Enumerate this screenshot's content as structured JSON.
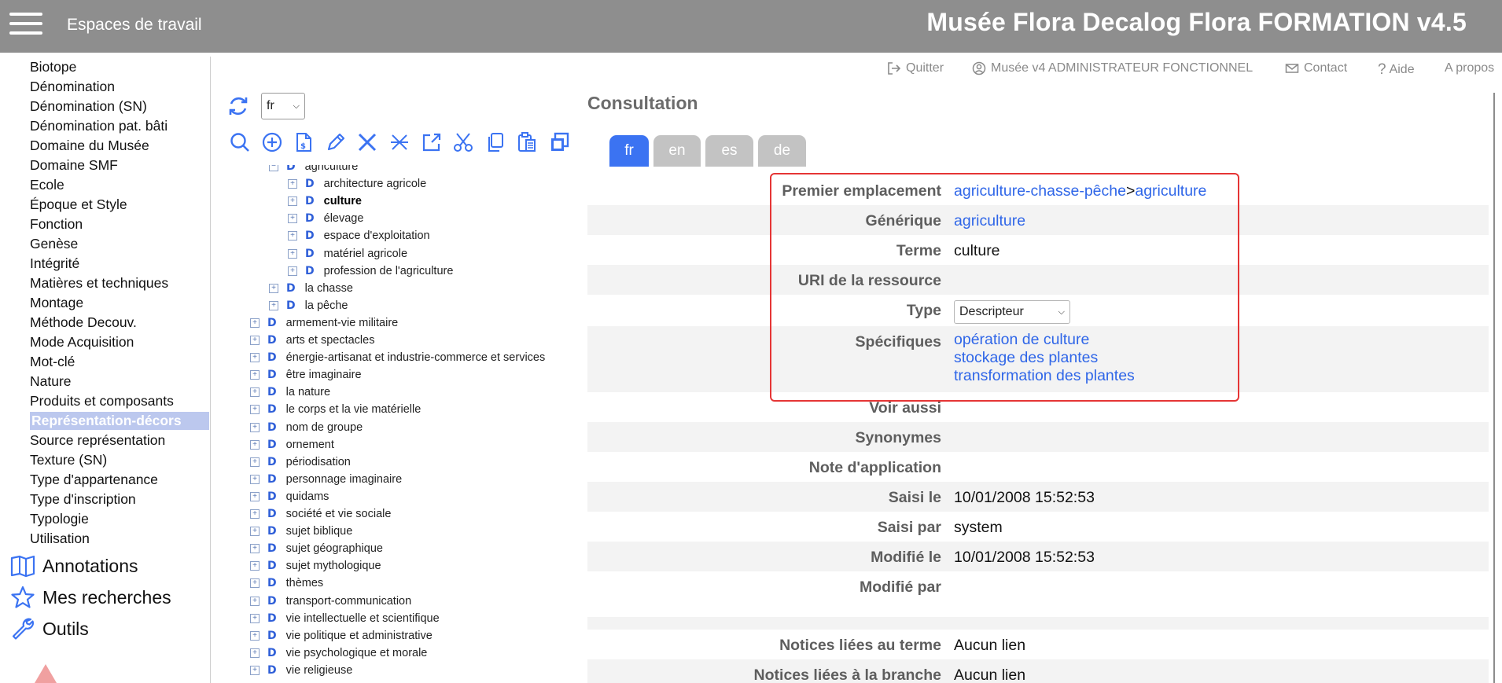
{
  "header": {
    "workspaces_label": "Espaces de travail",
    "app_title": "Musée Flora Decalog Flora FORMATION v4.5"
  },
  "sidebar": {
    "items": [
      "Biotope",
      "Dénomination",
      "Dénomination (SN)",
      "Dénomination pat. bâti",
      "Domaine du Musée",
      "Domaine SMF",
      "Ecole",
      "Époque et Style",
      "Fonction",
      "Genèse",
      "Intégrité",
      "Matières et techniques",
      "Montage",
      "Méthode Decouv.",
      "Mode Acquisition",
      "Mot-clé",
      "Nature",
      "Produits et composants",
      "Représentation-décors",
      "Source représentation",
      "Texture (SN)",
      "Type d'appartenance",
      "Type d'inscription",
      "Typologie",
      "Utilisation"
    ],
    "active_item": "Représentation-décors",
    "sections": {
      "annotations": "Annotations",
      "searches": "Mes recherches",
      "tools": "Outils"
    }
  },
  "toplinks": {
    "quit": "Quitter",
    "user": "Musée v4 ADMINISTRATEUR FONCTIONNEL",
    "contact": "Contact",
    "help": "Aide",
    "about": "A propos"
  },
  "tree_panel": {
    "language": "fr",
    "toolbar_icons": [
      "search-icon",
      "add-icon",
      "new-document-icon",
      "edit-icon",
      "delete-icon",
      "unlink-icon",
      "export-icon",
      "cut-icon",
      "copy-icon",
      "paste-icon",
      "duplicate-icon"
    ],
    "nodes": [
      {
        "label": "agriculture",
        "level": 2,
        "sign": "−"
      },
      {
        "label": "architecture agricole",
        "level": 3,
        "sign": "+"
      },
      {
        "label": "culture",
        "level": 3,
        "sign": "+",
        "bold": true
      },
      {
        "label": "élevage",
        "level": 3,
        "sign": "+"
      },
      {
        "label": "espace d'exploitation",
        "level": 3,
        "sign": "+"
      },
      {
        "label": "matériel agricole",
        "level": 3,
        "sign": "+"
      },
      {
        "label": "profession de l'agriculture",
        "level": 3,
        "sign": "+"
      },
      {
        "label": "la chasse",
        "level": 2,
        "sign": "+"
      },
      {
        "label": "la pêche",
        "level": 2,
        "sign": "+"
      },
      {
        "label": "armement-vie militaire",
        "level": 1,
        "sign": "+"
      },
      {
        "label": "arts et spectacles",
        "level": 1,
        "sign": "+"
      },
      {
        "label": "énergie-artisanat et industrie-commerce et services",
        "level": 1,
        "sign": "+"
      },
      {
        "label": "être imaginaire",
        "level": 1,
        "sign": "+"
      },
      {
        "label": "la nature",
        "level": 1,
        "sign": "+"
      },
      {
        "label": "le corps et la vie matérielle",
        "level": 1,
        "sign": "+"
      },
      {
        "label": "nom de groupe",
        "level": 1,
        "sign": "+"
      },
      {
        "label": "ornement",
        "level": 1,
        "sign": "+"
      },
      {
        "label": "périodisation",
        "level": 1,
        "sign": "+"
      },
      {
        "label": "personnage imaginaire",
        "level": 1,
        "sign": "+"
      },
      {
        "label": "quidams",
        "level": 1,
        "sign": "+"
      },
      {
        "label": "société et vie sociale",
        "level": 1,
        "sign": "+"
      },
      {
        "label": "sujet biblique",
        "level": 1,
        "sign": "+"
      },
      {
        "label": "sujet géographique",
        "level": 1,
        "sign": "+"
      },
      {
        "label": "sujet mythologique",
        "level": 1,
        "sign": "+"
      },
      {
        "label": "thèmes",
        "level": 1,
        "sign": "+"
      },
      {
        "label": "transport-communication",
        "level": 1,
        "sign": "+"
      },
      {
        "label": "vie intellectuelle et scientifique",
        "level": 1,
        "sign": "+"
      },
      {
        "label": "vie politique et administrative",
        "level": 1,
        "sign": "+"
      },
      {
        "label": "vie psychologique et morale",
        "level": 1,
        "sign": "+"
      },
      {
        "label": "vie religieuse",
        "level": 1,
        "sign": "+"
      }
    ],
    "node_type_letter": "D"
  },
  "consultation": {
    "title": "Consultation",
    "tabs": [
      "fr",
      "en",
      "es",
      "de"
    ],
    "selected_tab": "fr",
    "fields": {
      "premier_emplacement_label": "Premier emplacement",
      "premier_emplacement_parent": "agriculture-chasse-pêche",
      "premier_emplacement_sep": ">",
      "premier_emplacement_child": "agriculture",
      "generique_label": "Générique",
      "generique_value": "agriculture",
      "terme_label": "Terme",
      "terme_value": "culture",
      "uri_label": "URI de la ressource",
      "type_label": "Type",
      "type_value": "Descripteur",
      "specifiques_label": "Spécifiques",
      "specifiques_values": [
        "opération de culture",
        "stockage des plantes",
        "transformation des plantes"
      ],
      "voir_aussi_label": "Voir aussi",
      "synonymes_label": "Synonymes",
      "note_label": "Note d'application",
      "saisi_le_label": "Saisi le",
      "saisi_le_value": "10/01/2008 15:52:53",
      "saisi_par_label": "Saisi par",
      "saisi_par_value": "system",
      "modifie_le_label": "Modifié le",
      "modifie_le_value": "10/01/2008 15:52:53",
      "modifie_par_label": "Modifié par",
      "notices_terme_label": "Notices liées au terme",
      "notices_terme_value": "Aucun lien",
      "notices_branche_label": "Notices liées à la branche",
      "notices_branche_value": "Aucun lien"
    }
  },
  "colors": {
    "header_bg": "#8e8e8e",
    "accent_blue": "#3b73f2",
    "link_blue": "#2f66e8",
    "active_item_bg": "#bcc8ee",
    "highlight_red": "#e53535"
  }
}
